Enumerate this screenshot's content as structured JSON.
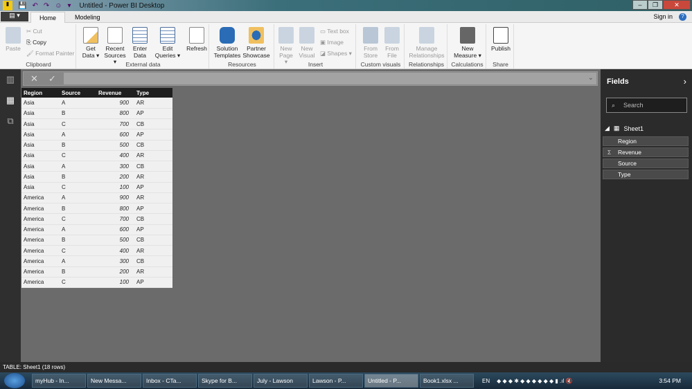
{
  "window": {
    "title": "Untitled - Power BI Desktop"
  },
  "tabs": [
    {
      "label": "Home"
    },
    {
      "label": "Modeling"
    }
  ],
  "header": {
    "sign_in": "Sign in",
    "help": "?"
  },
  "ribbon": {
    "clipboard": {
      "label": "Clipboard",
      "paste": "Paste",
      "cut": "Cut",
      "copy": "Copy",
      "format_painter": "Format Painter"
    },
    "external": {
      "label": "External data",
      "get_data": "Get Data ▾",
      "recent": "Recent Sources ▾",
      "enter": "Enter Data",
      "edit": "Edit Queries ▾",
      "refresh": "Refresh"
    },
    "resources": {
      "label": "Resources",
      "solution": "Solution Templates",
      "partner": "Partner Showcase"
    },
    "insert": {
      "label": "Insert",
      "new_page": "New Page ▾",
      "new_visual": "New Visual",
      "text_box": "Text box",
      "image": "Image",
      "shapes": "Shapes ▾"
    },
    "custom": {
      "label": "Custom visuals",
      "from_store": "From Store",
      "from_file": "From File"
    },
    "relationships": {
      "label": "Relationships",
      "manage": "Manage Relationships"
    },
    "calculations": {
      "label": "Calculations",
      "new_measure": "New Measure ▾"
    },
    "share": {
      "label": "Share",
      "publish": "Publish"
    }
  },
  "table": {
    "columns": [
      "Region",
      "Source",
      "Revenue",
      "Type"
    ],
    "rows": [
      [
        "Asia",
        "A",
        "900",
        "AR"
      ],
      [
        "Asia",
        "B",
        "800",
        "AP"
      ],
      [
        "Asia",
        "C",
        "700",
        "CB"
      ],
      [
        "Asia",
        "A",
        "600",
        "AP"
      ],
      [
        "Asia",
        "B",
        "500",
        "CB"
      ],
      [
        "Asia",
        "C",
        "400",
        "AR"
      ],
      [
        "Asia",
        "A",
        "300",
        "CB"
      ],
      [
        "Asia",
        "B",
        "200",
        "AR"
      ],
      [
        "Asia",
        "C",
        "100",
        "AP"
      ],
      [
        "America",
        "A",
        "900",
        "AR"
      ],
      [
        "America",
        "B",
        "800",
        "AP"
      ],
      [
        "America",
        "C",
        "700",
        "CB"
      ],
      [
        "America",
        "A",
        "600",
        "AP"
      ],
      [
        "America",
        "B",
        "500",
        "CB"
      ],
      [
        "America",
        "C",
        "400",
        "AR"
      ],
      [
        "America",
        "A",
        "300",
        "CB"
      ],
      [
        "America",
        "B",
        "200",
        "AR"
      ],
      [
        "America",
        "C",
        "100",
        "AP"
      ]
    ]
  },
  "fields": {
    "title": "Fields",
    "search_placeholder": "Search",
    "table_name": "Sheet1",
    "items": [
      {
        "label": "Region"
      },
      {
        "label": "Revenue",
        "sigma": "Σ"
      },
      {
        "label": "Source"
      },
      {
        "label": "Type"
      }
    ]
  },
  "status": {
    "text": "TABLE: Sheet1 (18 rows)"
  },
  "taskbar": {
    "items": [
      {
        "label": "myHub - In..."
      },
      {
        "label": "New Messa..."
      },
      {
        "label": "Inbox - CTa..."
      },
      {
        "label": "Skype for B..."
      },
      {
        "label": "July - Lawson"
      },
      {
        "label": "Lawson - P..."
      },
      {
        "label": "Untitled - P..."
      },
      {
        "label": "Book1.xlsx ..."
      }
    ],
    "lang": "EN",
    "clock": "3:54 PM"
  }
}
